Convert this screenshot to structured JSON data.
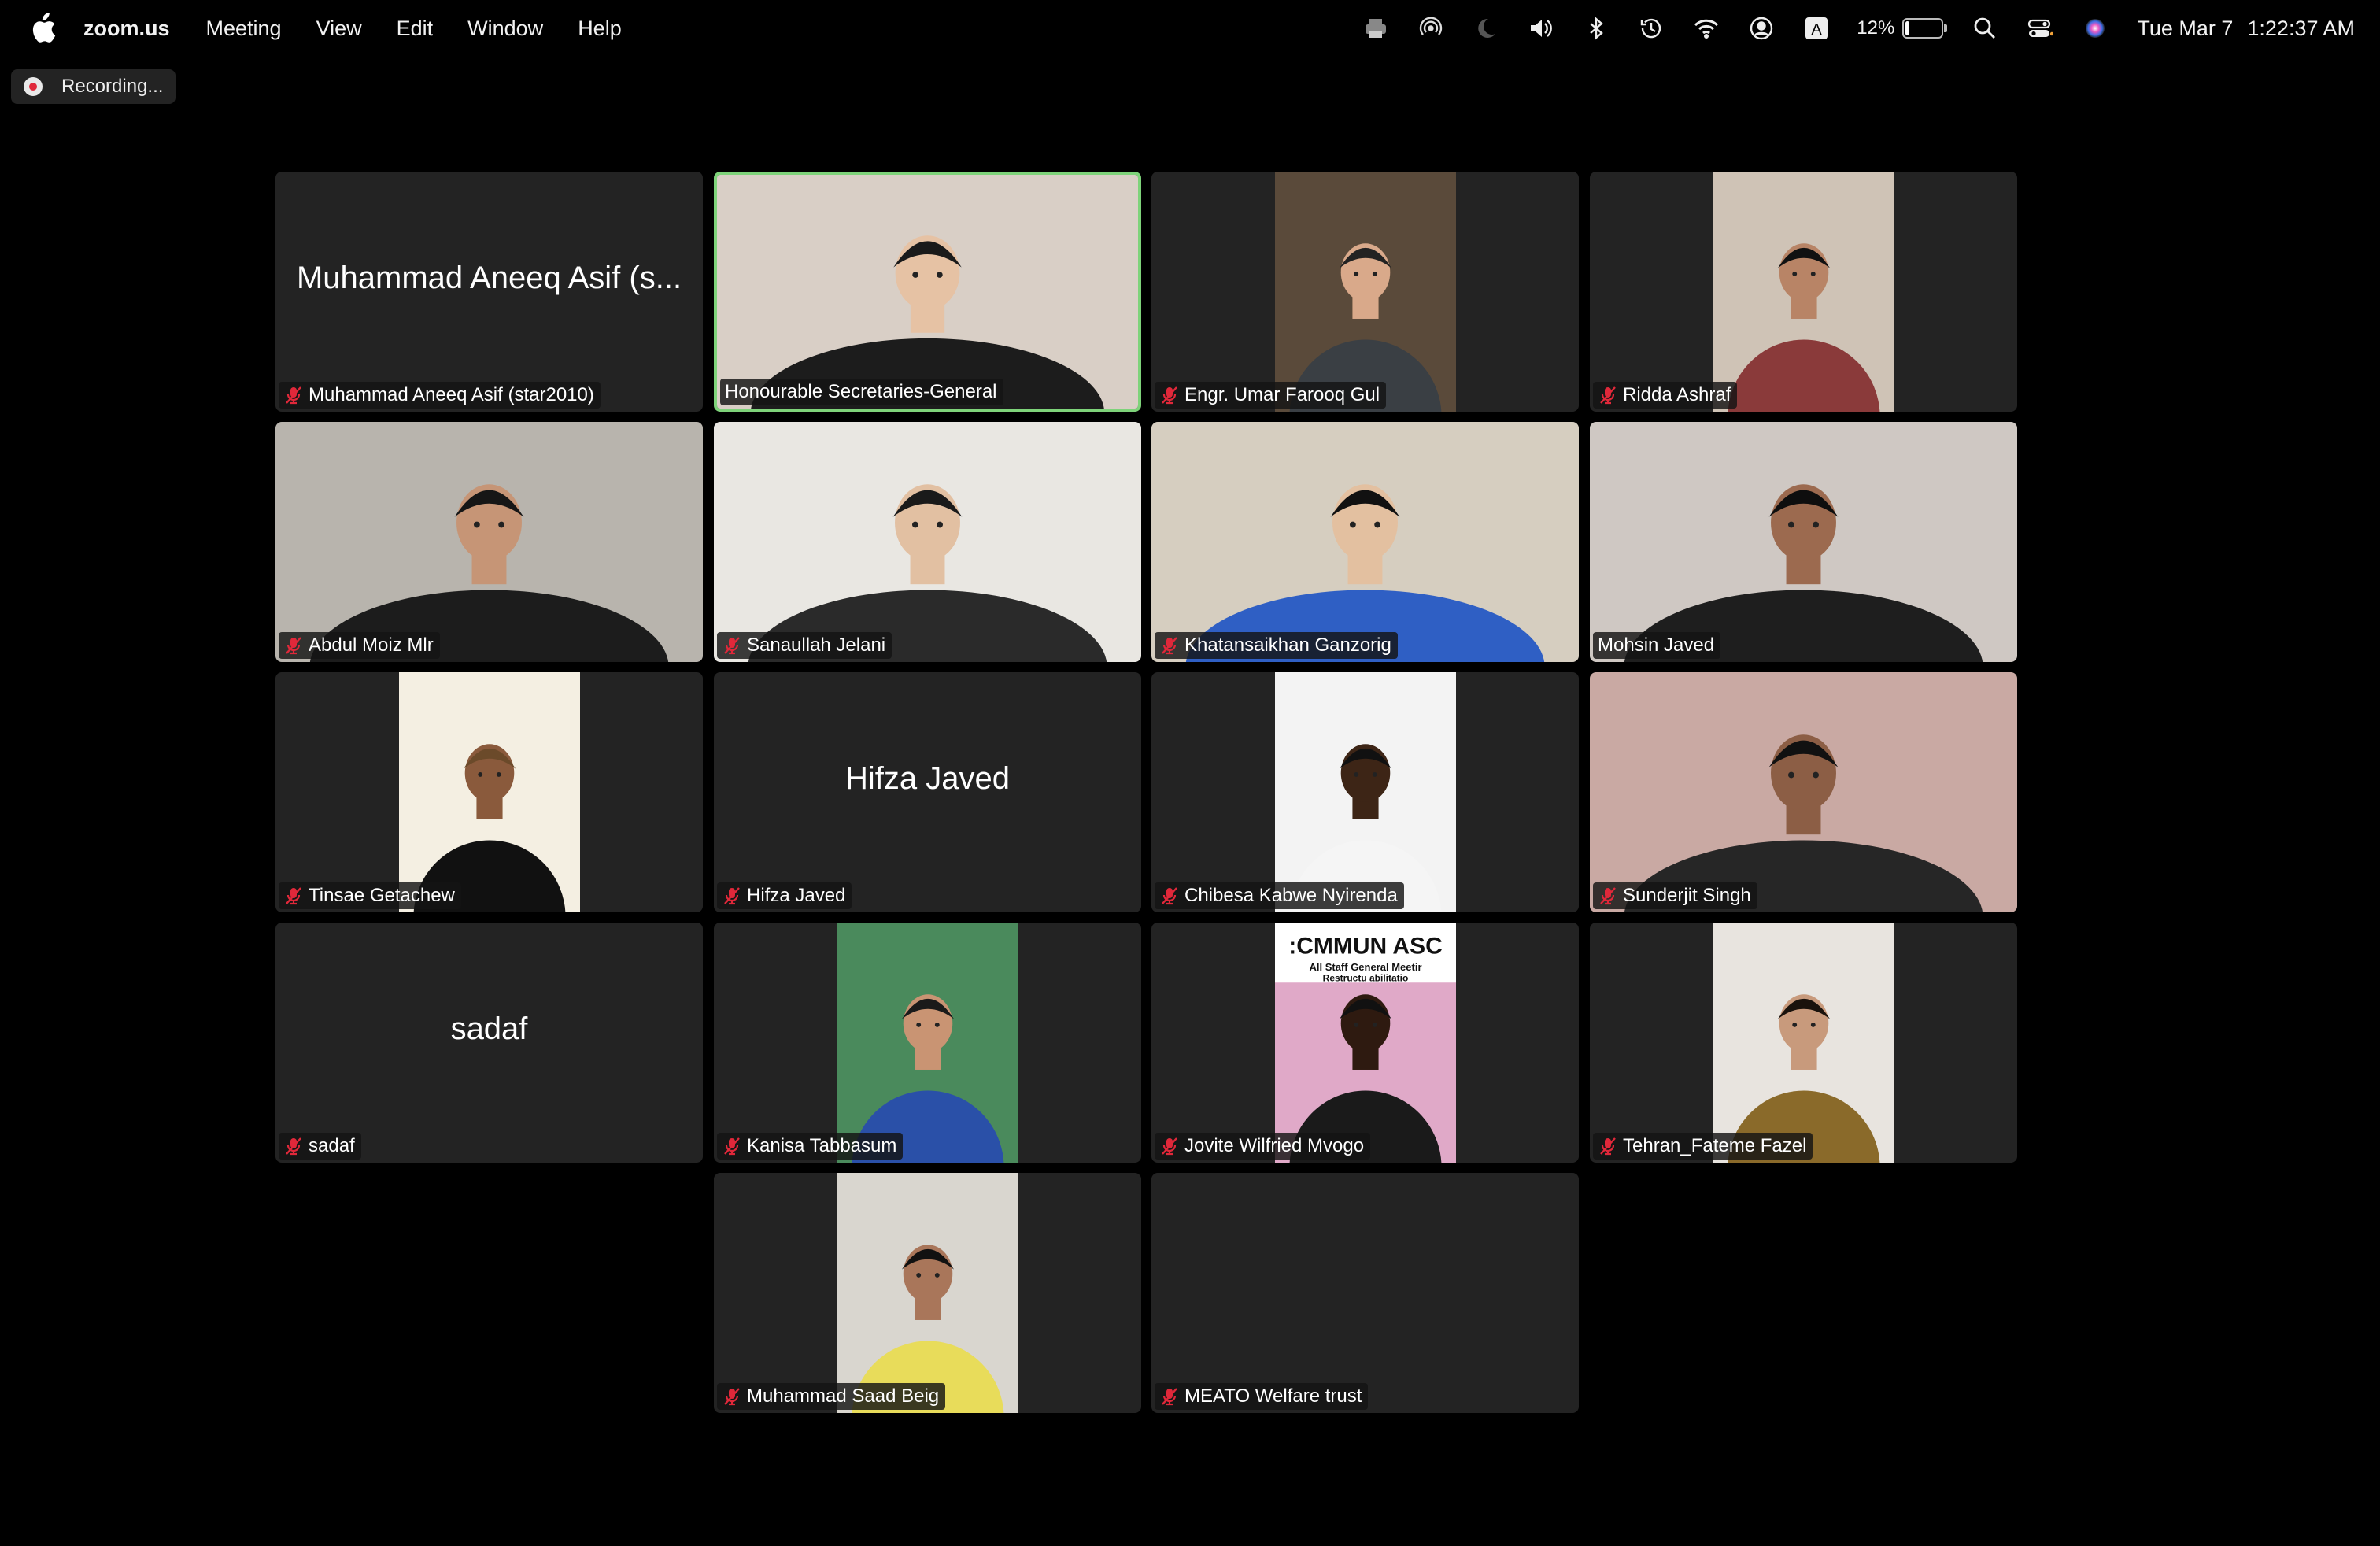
{
  "menubar": {
    "app": "zoom.us",
    "menus": [
      "Meeting",
      "View",
      "Edit",
      "Window",
      "Help"
    ],
    "battery_percent": "12%",
    "battery_level": 0.12,
    "date": "Tue Mar 7",
    "time": "1:22:37 AM",
    "status_icons": [
      "printer-icon",
      "airdrop-icon",
      "focus-moon-icon",
      "volume-icon",
      "bluetooth-icon",
      "time-machine-icon",
      "wifi-icon",
      "user-account-icon",
      "input-source-icon",
      "battery-icon",
      "spotlight-search-icon",
      "control-center-icon",
      "siri-icon"
    ]
  },
  "recording": {
    "label": "Recording..."
  },
  "participants": [
    {
      "name": "Muhammad Aneeq Asif (star2010)",
      "display_name": "Muhammad Aneeq Asif (s...",
      "video": false,
      "muted": true,
      "active_speaker": false
    },
    {
      "name": "Honourable Secretaries-General",
      "video": true,
      "muted": false,
      "active_speaker": true,
      "bg": "#d9cfc6",
      "skin": "#e6c2a4",
      "shirt": "#1c1c1c",
      "hair": "#1a1a1a",
      "full": true
    },
    {
      "name": "Engr. Umar Farooq Gul",
      "video": true,
      "muted": true,
      "active_speaker": false,
      "bg": "#5a4a3a",
      "skin": "#d9a98a",
      "shirt": "#3a3f44",
      "hair": "#222"
    },
    {
      "name": "Ridda Ashraf",
      "video": true,
      "muted": true,
      "active_speaker": false,
      "bg": "#cfc3b6",
      "skin": "#b88466",
      "shirt": "#8a3a3a",
      "hair": "#111"
    },
    {
      "name": "Abdul Moiz Mlr",
      "video": true,
      "muted": true,
      "active_speaker": false,
      "bg": "#b8b4ad",
      "skin": "#c69576",
      "shirt": "#1c1c1c",
      "hair": "#161616",
      "full": true
    },
    {
      "name": "Sanaullah Jelani",
      "video": true,
      "muted": true,
      "active_speaker": false,
      "bg": "#e9e7e2",
      "skin": "#e2c0a2",
      "shirt": "#2a2a2a",
      "hair": "#1a1a1a",
      "full": true
    },
    {
      "name": "Khatansaikhan Ganzorig",
      "video": true,
      "muted": true,
      "active_speaker": false,
      "bg": "#d6cec0",
      "skin": "#e3c0a0",
      "shirt": "#2f5fc4",
      "hair": "#111",
      "full": true
    },
    {
      "name": "Mohsin Javed",
      "video": true,
      "muted": false,
      "active_speaker": false,
      "bg": "#cfc8c3",
      "skin": "#9c6a4f",
      "shirt": "#1e1e1e",
      "hair": "#0e0e0e",
      "full": true
    },
    {
      "name": "Tinsae Getachew",
      "video": true,
      "muted": true,
      "active_speaker": false,
      "bg": "#f4efe2",
      "skin": "#8a5a3c",
      "shirt": "#111",
      "hair": "#6b4a2a"
    },
    {
      "name": "Hifza Javed",
      "video": false,
      "muted": true,
      "active_speaker": false
    },
    {
      "name": "Chibesa Kabwe Nyirenda",
      "video": true,
      "muted": true,
      "active_speaker": false,
      "bg": "#f3f3f3",
      "skin": "#3d2516",
      "shirt": "#f5f5f5",
      "hair": "#111"
    },
    {
      "name": "Sunderjit Singh",
      "video": true,
      "muted": true,
      "active_speaker": false,
      "bg": "#c9a9a3",
      "skin": "#8c5e45",
      "shirt": "#262626",
      "hair": "#111",
      "full": true
    },
    {
      "name": "sadaf",
      "video": false,
      "muted": true,
      "active_speaker": false
    },
    {
      "name": "Kanisa Tabbasum",
      "video": true,
      "muted": true,
      "active_speaker": false,
      "bg": "#4a8a5c",
      "skin": "#c99473",
      "shirt": "#2a50a8",
      "hair": "#1a1a1a"
    },
    {
      "name": "Jovite Wilfried Mvogo",
      "video": true,
      "muted": true,
      "active_speaker": false,
      "bg": "#e0a9c8",
      "skin": "#2e1a10",
      "shirt": "#1a1a1a",
      "hair": "#111",
      "poster_title": ":CMMUN ASC",
      "poster_line1": "All Staff General Meetir",
      "poster_line2": "Restructu          abilitatio"
    },
    {
      "name": "Tehran_Fateme Fazel",
      "video": true,
      "muted": true,
      "active_speaker": false,
      "bg": "#e8e4df",
      "skin": "#c89a7c",
      "shirt": "#8a6a2a",
      "hair": "#1a120c"
    },
    {
      "name": "Muhammad Saad Beig",
      "video": true,
      "muted": true,
      "active_speaker": false,
      "bg": "#d9d6cf",
      "skin": "#a9765a",
      "shirt": "#e8dc5a",
      "hair": "#111"
    },
    {
      "name": "MEATO Welfare trust",
      "video": false,
      "muted": true,
      "active_speaker": false,
      "hide_big": true
    }
  ]
}
